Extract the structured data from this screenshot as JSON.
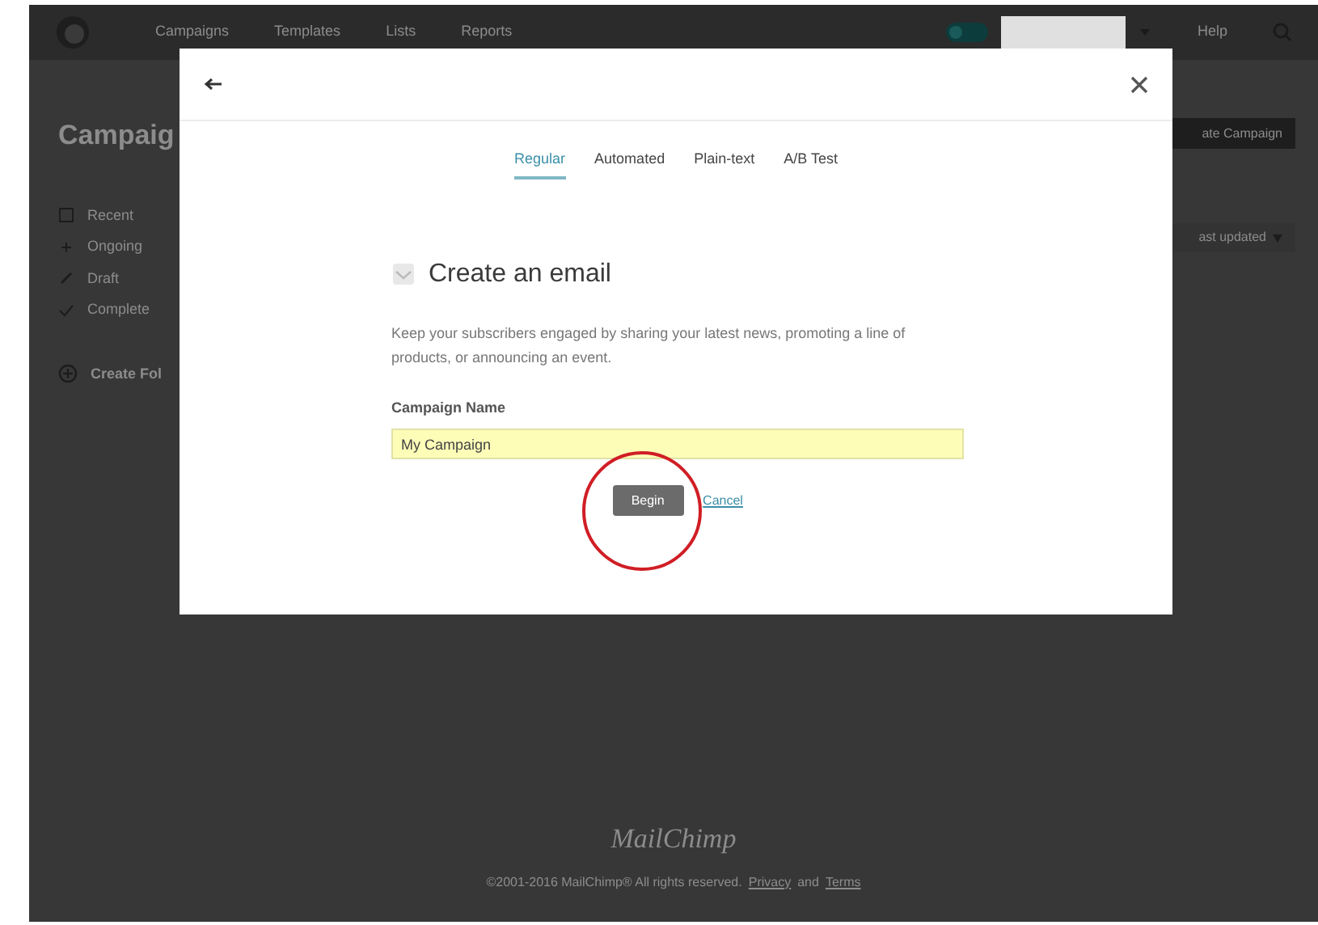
{
  "top_nav": {
    "items": [
      {
        "label": "Campaigns"
      },
      {
        "label": "Templates"
      },
      {
        "label": "Lists"
      },
      {
        "label": "Reports"
      }
    ],
    "help": "Help"
  },
  "page": {
    "title": "Campaig",
    "primary_button": "ate Campaign",
    "sort_dropdown": "ast updated",
    "filters": [
      {
        "label": "Recent",
        "kind": "recent"
      },
      {
        "label": "Ongoing",
        "kind": "ongoing"
      },
      {
        "label": "Draft",
        "kind": "draft"
      },
      {
        "label": "Complete",
        "kind": "completed"
      }
    ],
    "create_folder": "Create Fol"
  },
  "footer": {
    "logo": "MailChimp",
    "copyright": "©2001-2016 MailChimp® All rights reserved.",
    "privacy": "Privacy",
    "and": "and",
    "terms": "Terms"
  },
  "modal": {
    "tabs": [
      {
        "label": "Regular",
        "selected": true
      },
      {
        "label": "Automated",
        "selected": false
      },
      {
        "label": "Plain-text",
        "selected": false
      },
      {
        "label": "A/B Test",
        "selected": false
      }
    ],
    "heading": "Create an email",
    "description": "Keep your subscribers engaged by sharing your latest news, promoting a line of products, or announcing an event.",
    "field_label": "Campaign Name",
    "field_value": "My Campaign",
    "begin": "Begin",
    "cancel": "Cancel"
  }
}
